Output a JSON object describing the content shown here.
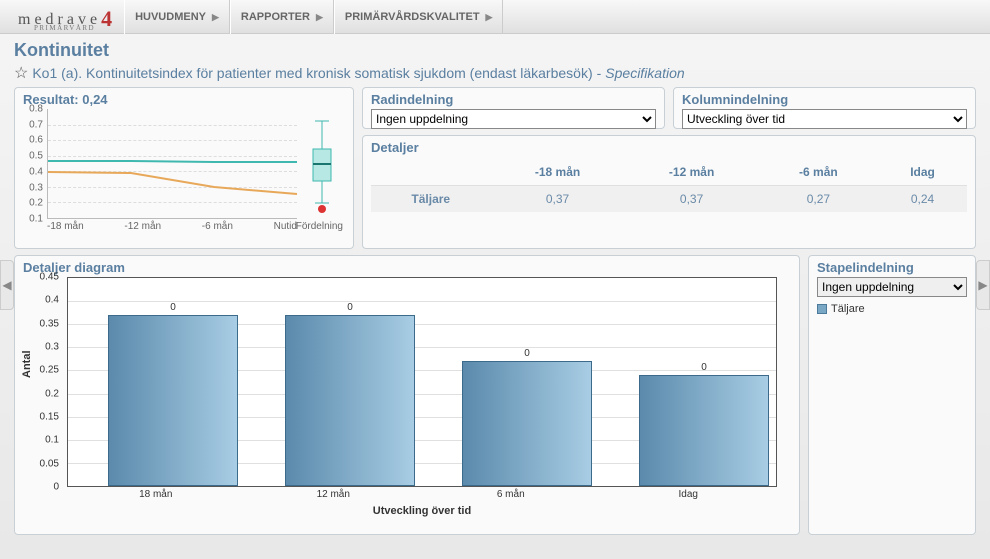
{
  "nav": {
    "logo_main": "medrave",
    "logo_four": "4",
    "logo_sub": "PRIMÄRVÅRD",
    "items": [
      "HUVUDMENY",
      "RAPPORTER",
      "PRIMÄRVÅRDSKVALITET"
    ]
  },
  "page": {
    "title": "Kontinuitet",
    "subtitle": "Ko1 (a). Kontinuitetsindex för patienter med kronisk somatisk sjukdom (endast läkarbesök)",
    "dash": " - ",
    "spec": "Specifikation"
  },
  "resultat": {
    "title": "Resultat: 0,24",
    "y_ticks": [
      "0.8",
      "0.7",
      "0.6",
      "0.5",
      "0.4",
      "0.3",
      "0.2",
      "0.1"
    ],
    "x_ticks": [
      "-18 mån",
      "-12 mån",
      "-6 mån",
      "Nutid"
    ],
    "box_label": "Fördelning"
  },
  "radindelning": {
    "title": "Radindelning",
    "value": "Ingen uppdelning"
  },
  "kolumnindelning": {
    "title": "Kolumnindelning",
    "value": "Utveckling över tid"
  },
  "detaljer": {
    "title": "Detaljer",
    "headers": [
      "",
      "-18 mån",
      "-12 mån",
      "-6 mån",
      "Idag"
    ],
    "row_label": "Täljare",
    "values": [
      "0,37",
      "0,37",
      "0,27",
      "0,24"
    ]
  },
  "diagram": {
    "title": "Detaljer diagram",
    "y_ticks": [
      "0.45",
      "0.4",
      "0.35",
      "0.3",
      "0.25",
      "0.2",
      "0.15",
      "0.1",
      "0.05",
      "0"
    ],
    "ylabel": "Antal",
    "x_ticks": [
      "18 mån",
      "12 mån",
      "6 mån",
      "Idag"
    ],
    "xlabel": "Utveckling över tid",
    "bar_label": "0"
  },
  "stapel": {
    "title": "Stapelindelning",
    "value": "Ingen uppdelning",
    "legend": "Täljare"
  },
  "chart_data": [
    {
      "type": "line",
      "title": "Resultat: 0,24",
      "x": [
        "-18 mån",
        "-12 mån",
        "-6 mån",
        "Nutid"
      ],
      "series": [
        {
          "name": "teal",
          "values": [
            0.47,
            0.47,
            0.46,
            0.46
          ]
        },
        {
          "name": "orange",
          "values": [
            0.4,
            0.39,
            0.3,
            0.26
          ]
        }
      ],
      "ylim": [
        0.1,
        0.8
      ],
      "boxplot": {
        "min": 0.2,
        "q1": 0.35,
        "median": 0.45,
        "q3": 0.55,
        "max": 0.72,
        "outlier": 0.18
      }
    },
    {
      "type": "bar",
      "title": "Detaljer diagram",
      "categories": [
        "18 mån",
        "12 mån",
        "6 mån",
        "Idag"
      ],
      "series": [
        {
          "name": "Täljare",
          "values": [
            0.37,
            0.37,
            0.27,
            0.24
          ]
        }
      ],
      "xlabel": "Utveckling över tid",
      "ylabel": "Antal",
      "ylim": [
        0,
        0.45
      ]
    }
  ]
}
